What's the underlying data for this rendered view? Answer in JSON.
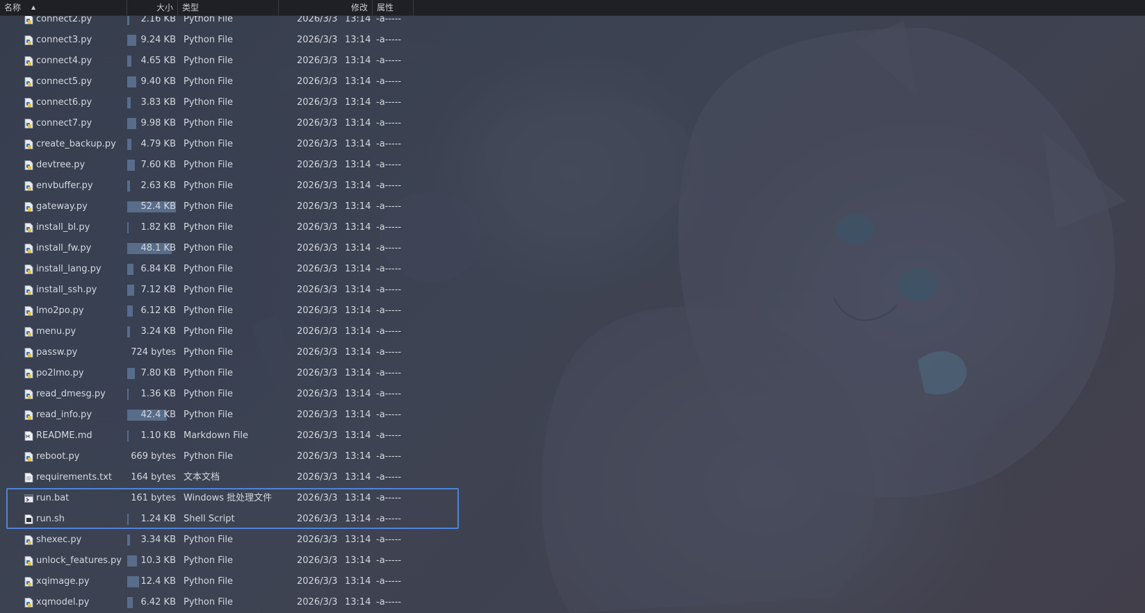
{
  "header": {
    "name_label": "名称",
    "sort_icon": "sort-ascending-icon",
    "size_label": "大小",
    "type_label": "类型",
    "modified_label": "修改",
    "attributes_label": "属性"
  },
  "colors": {
    "header_bg": "#1f2026",
    "selection_border": "#4f84d8",
    "size_bar": "#5c7290"
  },
  "files": [
    {
      "name": "connect2.py",
      "size": "2.16 KB",
      "size_fraction": 0.04,
      "type": "Python File",
      "date": "2026/3/3",
      "time": "13:14",
      "attr": "-a-----",
      "icon": "python-file-icon"
    },
    {
      "name": "connect3.py",
      "size": "9.24 KB",
      "size_fraction": 0.18,
      "type": "Python File",
      "date": "2026/3/3",
      "time": "13:14",
      "attr": "-a-----",
      "icon": "python-file-icon"
    },
    {
      "name": "connect4.py",
      "size": "4.65 KB",
      "size_fraction": 0.09,
      "type": "Python File",
      "date": "2026/3/3",
      "time": "13:14",
      "attr": "-a-----",
      "icon": "python-file-icon"
    },
    {
      "name": "connect5.py",
      "size": "9.40 KB",
      "size_fraction": 0.18,
      "type": "Python File",
      "date": "2026/3/3",
      "time": "13:14",
      "attr": "-a-----",
      "icon": "python-file-icon"
    },
    {
      "name": "connect6.py",
      "size": "3.83 KB",
      "size_fraction": 0.07,
      "type": "Python File",
      "date": "2026/3/3",
      "time": "13:14",
      "attr": "-a-----",
      "icon": "python-file-icon"
    },
    {
      "name": "connect7.py",
      "size": "9.98 KB",
      "size_fraction": 0.19,
      "type": "Python File",
      "date": "2026/3/3",
      "time": "13:14",
      "attr": "-a-----",
      "icon": "python-file-icon"
    },
    {
      "name": "create_backup.py",
      "size": "4.79 KB",
      "size_fraction": 0.09,
      "type": "Python File",
      "date": "2026/3/3",
      "time": "13:14",
      "attr": "-a-----",
      "icon": "python-file-icon"
    },
    {
      "name": "devtree.py",
      "size": "7.60 KB",
      "size_fraction": 0.15,
      "type": "Python File",
      "date": "2026/3/3",
      "time": "13:14",
      "attr": "-a-----",
      "icon": "python-file-icon"
    },
    {
      "name": "envbuffer.py",
      "size": "2.63 KB",
      "size_fraction": 0.05,
      "type": "Python File",
      "date": "2026/3/3",
      "time": "13:14",
      "attr": "-a-----",
      "icon": "python-file-icon"
    },
    {
      "name": "gateway.py",
      "size": "52.4 KB",
      "size_fraction": 1.0,
      "type": "Python File",
      "date": "2026/3/3",
      "time": "13:14",
      "attr": "-a-----",
      "icon": "python-file-icon"
    },
    {
      "name": "install_bl.py",
      "size": "1.82 KB",
      "size_fraction": 0.035,
      "type": "Python File",
      "date": "2026/3/3",
      "time": "13:14",
      "attr": "-a-----",
      "icon": "python-file-icon"
    },
    {
      "name": "install_fw.py",
      "size": "48.1 KB",
      "size_fraction": 0.92,
      "type": "Python File",
      "date": "2026/3/3",
      "time": "13:14",
      "attr": "-a-----",
      "icon": "python-file-icon"
    },
    {
      "name": "install_lang.py",
      "size": "6.84 KB",
      "size_fraction": 0.13,
      "type": "Python File",
      "date": "2026/3/3",
      "time": "13:14",
      "attr": "-a-----",
      "icon": "python-file-icon"
    },
    {
      "name": "install_ssh.py",
      "size": "7.12 KB",
      "size_fraction": 0.14,
      "type": "Python File",
      "date": "2026/3/3",
      "time": "13:14",
      "attr": "-a-----",
      "icon": "python-file-icon"
    },
    {
      "name": "lmo2po.py",
      "size": "6.12 KB",
      "size_fraction": 0.12,
      "type": "Python File",
      "date": "2026/3/3",
      "time": "13:14",
      "attr": "-a-----",
      "icon": "python-file-icon"
    },
    {
      "name": "menu.py",
      "size": "3.24 KB",
      "size_fraction": 0.06,
      "type": "Python File",
      "date": "2026/3/3",
      "time": "13:14",
      "attr": "-a-----",
      "icon": "python-file-icon"
    },
    {
      "name": "passw.py",
      "size": "724 bytes",
      "size_fraction": 0.0,
      "type": "Python File",
      "date": "2026/3/3",
      "time": "13:14",
      "attr": "-a-----",
      "icon": "python-file-icon"
    },
    {
      "name": "po2lmo.py",
      "size": "7.80 KB",
      "size_fraction": 0.15,
      "type": "Python File",
      "date": "2026/3/3",
      "time": "13:14",
      "attr": "-a-----",
      "icon": "python-file-icon"
    },
    {
      "name": "read_dmesg.py",
      "size": "1.36 KB",
      "size_fraction": 0.026,
      "type": "Python File",
      "date": "2026/3/3",
      "time": "13:14",
      "attr": "-a-----",
      "icon": "python-file-icon"
    },
    {
      "name": "read_info.py",
      "size": "42.4 KB",
      "size_fraction": 0.81,
      "type": "Python File",
      "date": "2026/3/3",
      "time": "13:14",
      "attr": "-a-----",
      "icon": "python-file-icon"
    },
    {
      "name": "README.md",
      "size": "1.10 KB",
      "size_fraction": 0.021,
      "type": "Markdown File",
      "date": "2026/3/3",
      "time": "13:14",
      "attr": "-a-----",
      "icon": "markdown-file-icon"
    },
    {
      "name": "reboot.py",
      "size": "669 bytes",
      "size_fraction": 0.0,
      "type": "Python File",
      "date": "2026/3/3",
      "time": "13:14",
      "attr": "-a-----",
      "icon": "python-file-icon"
    },
    {
      "name": "requirements.txt",
      "size": "164 bytes",
      "size_fraction": 0.0,
      "type": "文本文档",
      "date": "2026/3/3",
      "time": "13:14",
      "attr": "-a-----",
      "icon": "text-file-icon"
    },
    {
      "name": "run.bat",
      "size": "161 bytes",
      "size_fraction": 0.0,
      "type": "Windows 批处理文件",
      "date": "2026/3/3",
      "time": "13:14",
      "attr": "-a-----",
      "icon": "batch-file-icon"
    },
    {
      "name": "run.sh",
      "size": "1.24 KB",
      "size_fraction": 0.024,
      "type": "Shell Script",
      "date": "2026/3/3",
      "time": "13:14",
      "attr": "-a-----",
      "icon": "shell-script-icon"
    },
    {
      "name": "shexec.py",
      "size": "3.34 KB",
      "size_fraction": 0.064,
      "type": "Python File",
      "date": "2026/3/3",
      "time": "13:14",
      "attr": "-a-----",
      "icon": "python-file-icon"
    },
    {
      "name": "unlock_features.py",
      "size": "10.3 KB",
      "size_fraction": 0.2,
      "type": "Python File",
      "date": "2026/3/3",
      "time": "13:14",
      "attr": "-a-----",
      "icon": "python-file-icon"
    },
    {
      "name": "xqimage.py",
      "size": "12.4 KB",
      "size_fraction": 0.24,
      "type": "Python File",
      "date": "2026/3/3",
      "time": "13:14",
      "attr": "-a-----",
      "icon": "python-file-icon"
    },
    {
      "name": "xqmodel.py",
      "size": "6.42 KB",
      "size_fraction": 0.12,
      "type": "Python File",
      "date": "2026/3/3",
      "time": "13:14",
      "attr": "-a-----",
      "icon": "python-file-icon"
    }
  ]
}
